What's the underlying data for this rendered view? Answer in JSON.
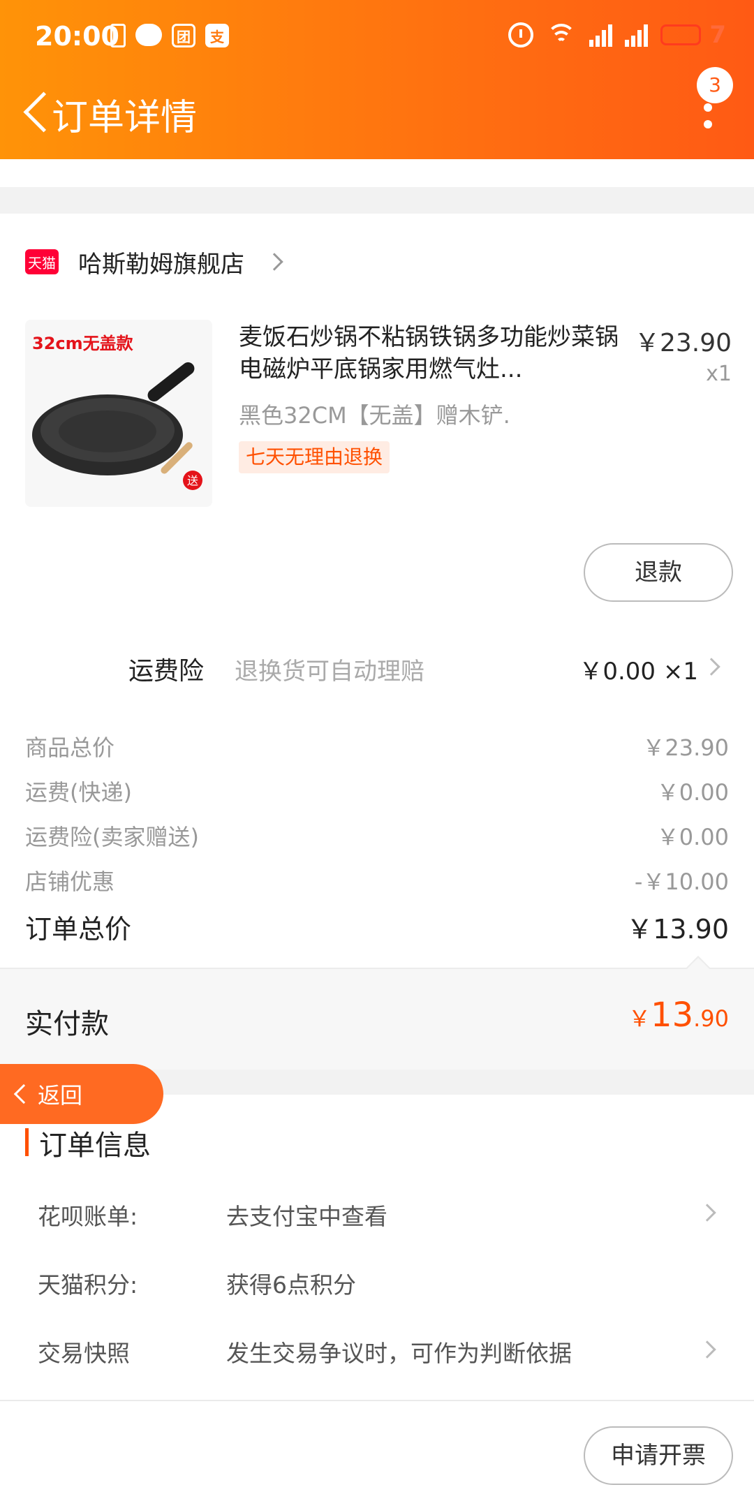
{
  "status_bar": {
    "time": "20:00",
    "battery": "7"
  },
  "nav": {
    "title": "订单详情",
    "badge": "3"
  },
  "store": {
    "logo_text": "天猫",
    "name": "哈斯勒姆旗舰店"
  },
  "product": {
    "image_label": "32cm无盖款",
    "image_tag": "送",
    "title": "麦饭石炒锅不粘锅铁锅多功能炒菜锅电磁炉平底锅家用燃气灶...",
    "price": "￥23.90",
    "qty": "x1",
    "spec": "黑色32CM【无盖】赠木铲.",
    "return_badge": "七天无理由退换",
    "refund_label": "退款"
  },
  "insurance": {
    "label": "运费险",
    "desc": "退换货可自动理赔",
    "price": "￥0.00 ×1"
  },
  "summary": [
    {
      "label": "商品总价",
      "value": "￥23.90"
    },
    {
      "label": "运费(快递)",
      "value": "￥0.00"
    },
    {
      "label": "运费险(卖家赠送)",
      "value": "￥0.00"
    },
    {
      "label": "店铺优惠",
      "value": "-￥10.00"
    }
  ],
  "order_total": {
    "label": "订单总价",
    "value": "￥13.90"
  },
  "paid": {
    "label": "实付款",
    "currency": "￥",
    "integer": "13",
    "decimal": ".90"
  },
  "back_button": {
    "label": "返回"
  },
  "order_info": {
    "title": "订单信息",
    "rows": [
      {
        "key": "花呗账单:",
        "value": "去支付宝中查看"
      },
      {
        "key": "天猫积分:",
        "value": "获得6点积分"
      },
      {
        "key": "交易快照",
        "value": "发生交易争议时，可作为判断依据"
      }
    ]
  },
  "bottom": {
    "invoice_label": "申请开票"
  },
  "colors": {
    "header_start": "#ff9308",
    "header_end": "#ff5a14",
    "accent": "#ff5000",
    "tmall": "#ff0036"
  }
}
